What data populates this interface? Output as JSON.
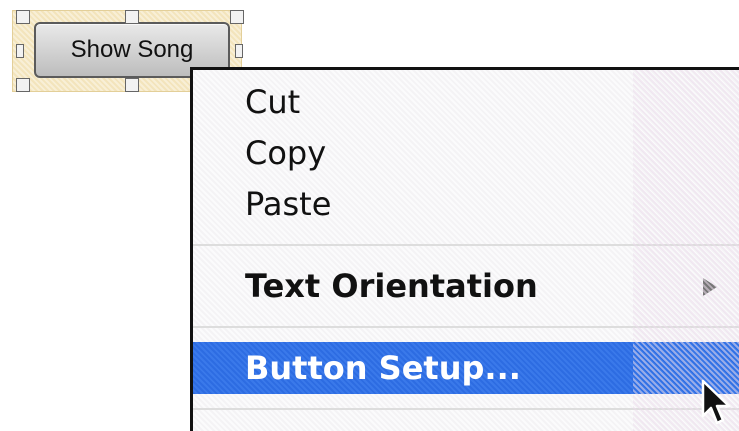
{
  "selected_button": {
    "label": "Show Song"
  },
  "context_menu": {
    "items": [
      {
        "label": "Cut"
      },
      {
        "label": "Copy"
      },
      {
        "label": "Paste"
      },
      {
        "label": "Text Orientation",
        "submenu": true
      },
      {
        "label": "Button Setup...",
        "highlighted": true
      }
    ]
  },
  "colors": {
    "highlight": "#2d6ce2",
    "menu_text": "#111111",
    "highlight_text": "#ffffff"
  },
  "icons": {
    "submenu": "chevron-right-icon",
    "cursor": "arrow-cursor-icon"
  }
}
